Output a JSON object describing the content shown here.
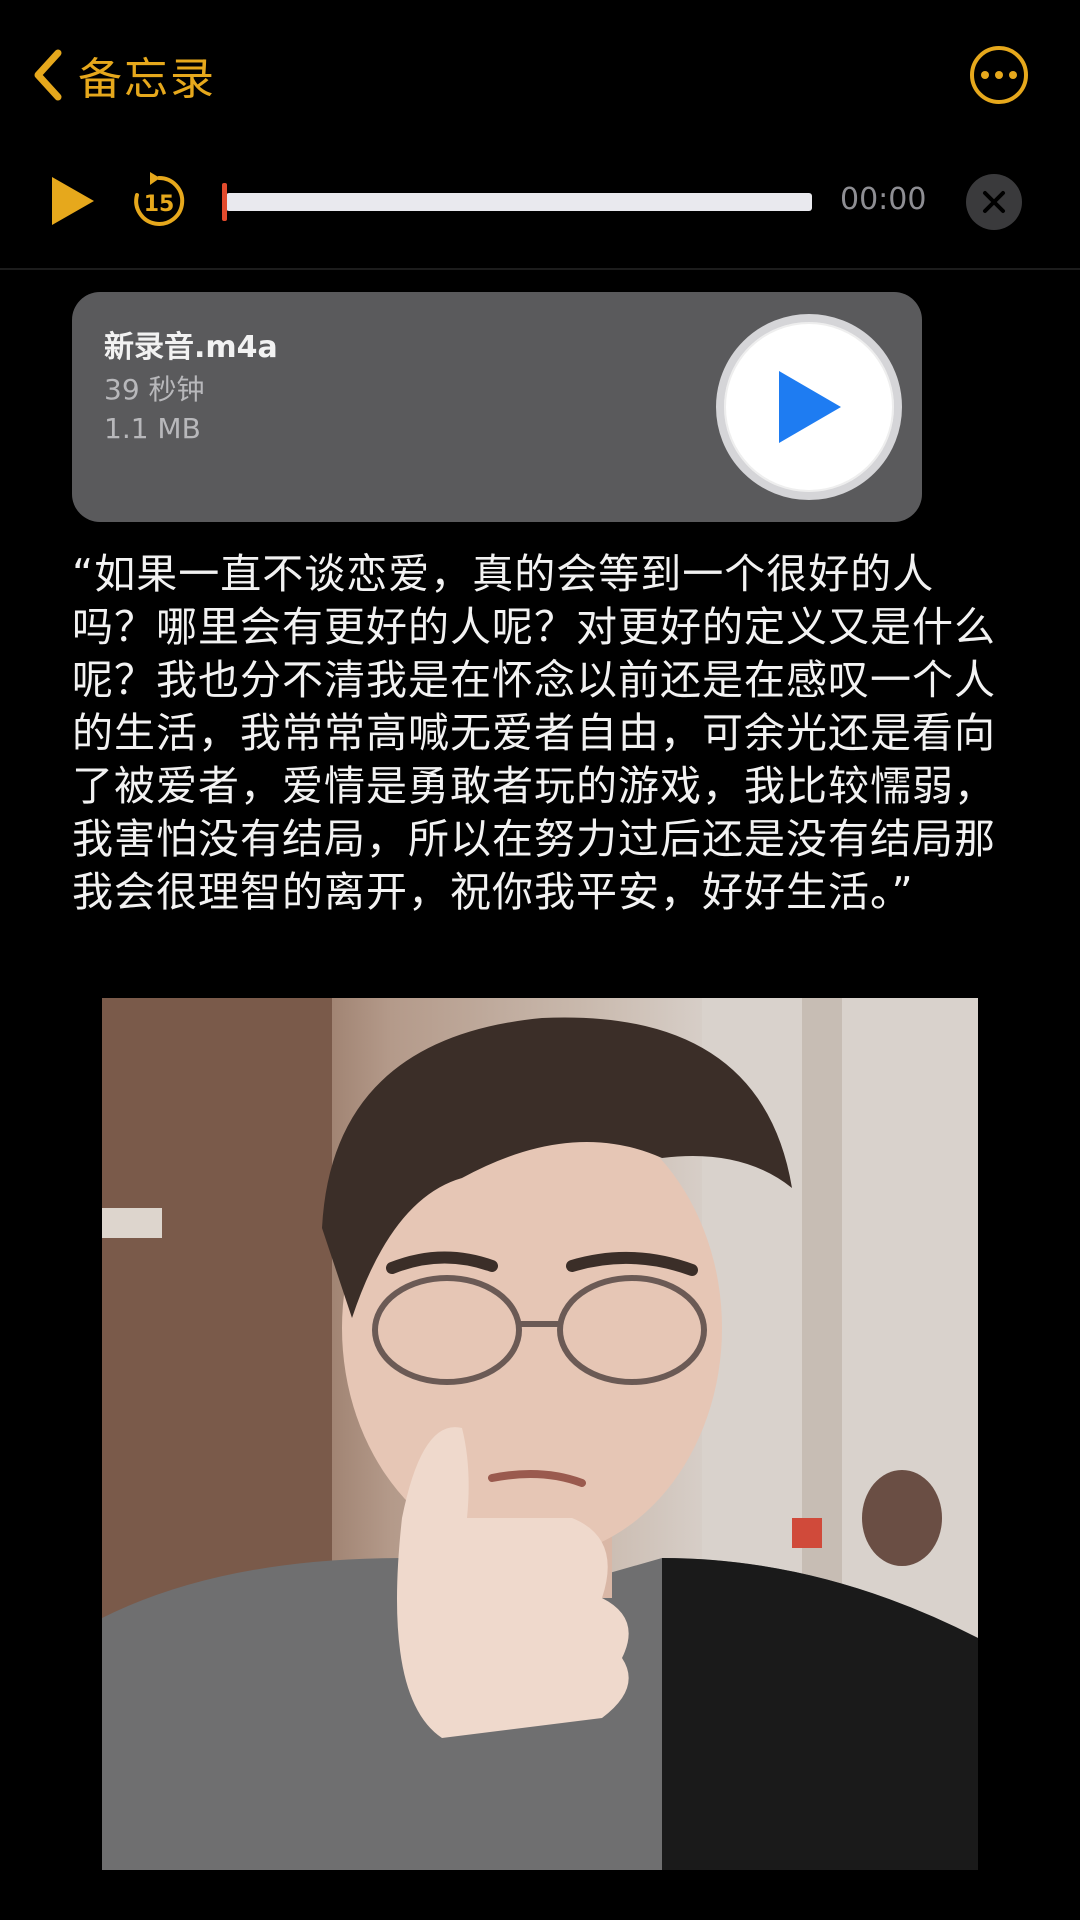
{
  "nav": {
    "back_label": "备忘录"
  },
  "player": {
    "skip_seconds": "15",
    "time": "00:00",
    "progress": 0
  },
  "attachment": {
    "filename": "新录音.m4a",
    "duration": "39 秒钟",
    "size": "1.1 MB"
  },
  "note": {
    "text": "“如果一直不谈恋爱，真的会等到一个很好的人吗？哪里会有更好的人呢？对更好的定义又是什么呢？我也分不清我是在怀念以前还是在感叹一个人的生活，我常常高喊无爱者自由，可余光还是看向了被爱者，爱情是勇敢者玩的游戏，我比较懦弱，我害怕没有结局，所以在努力过后还是没有结局那我会很理智的离开，祝你我平安，好好生活。”"
  },
  "colors": {
    "accent": "#e6a81c",
    "play_blue": "#1e7cf2",
    "progress_thumb": "#e24b2d"
  },
  "icons": [
    "chevron-left-icon",
    "more-icon",
    "play-icon",
    "skip-back-15-icon",
    "close-icon"
  ]
}
